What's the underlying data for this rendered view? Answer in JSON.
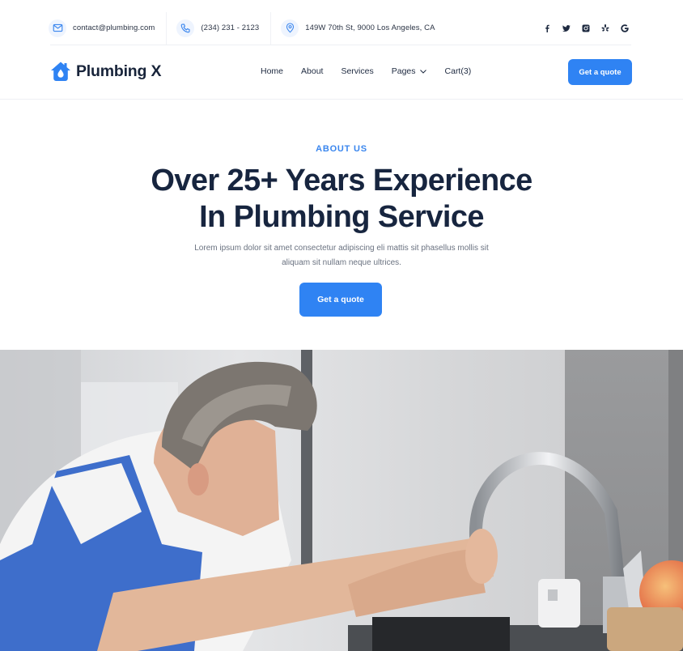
{
  "topbar": {
    "contacts": [
      {
        "icon": "mail-icon",
        "text": "contact@plumbing.com"
      },
      {
        "icon": "phone-icon",
        "text": "(234) 231 - 2123"
      },
      {
        "icon": "location-pin-icon",
        "text": "149W 70th St, 9000 Los Angeles, CA"
      }
    ],
    "socials": [
      "facebook",
      "twitter",
      "instagram",
      "yelp",
      "google"
    ]
  },
  "header": {
    "logo_text": "Plumbing X",
    "nav": [
      {
        "label": "Home"
      },
      {
        "label": "About"
      },
      {
        "label": "Services"
      },
      {
        "label": "Pages",
        "has_dropdown": true
      },
      {
        "label": "Cart(3)"
      }
    ],
    "cta_label": "Get a quote"
  },
  "hero": {
    "eyebrow": "ABOUT US",
    "title_line1": "Over 25+ Years Experience",
    "title_line2": "In Plumbing Service",
    "description": "Lorem ipsum dolor sit amet consectetur adipiscing eli mattis sit phasellus mollis sit aliquam sit nullam neque ultrices.",
    "cta_label": "Get a quote",
    "image_alt": "Plumber in blue overalls adjusting a chrome kitchen faucet"
  },
  "colors": {
    "accent": "#2f83f3",
    "heading": "#17253f",
    "body_text": "#6a7280"
  }
}
